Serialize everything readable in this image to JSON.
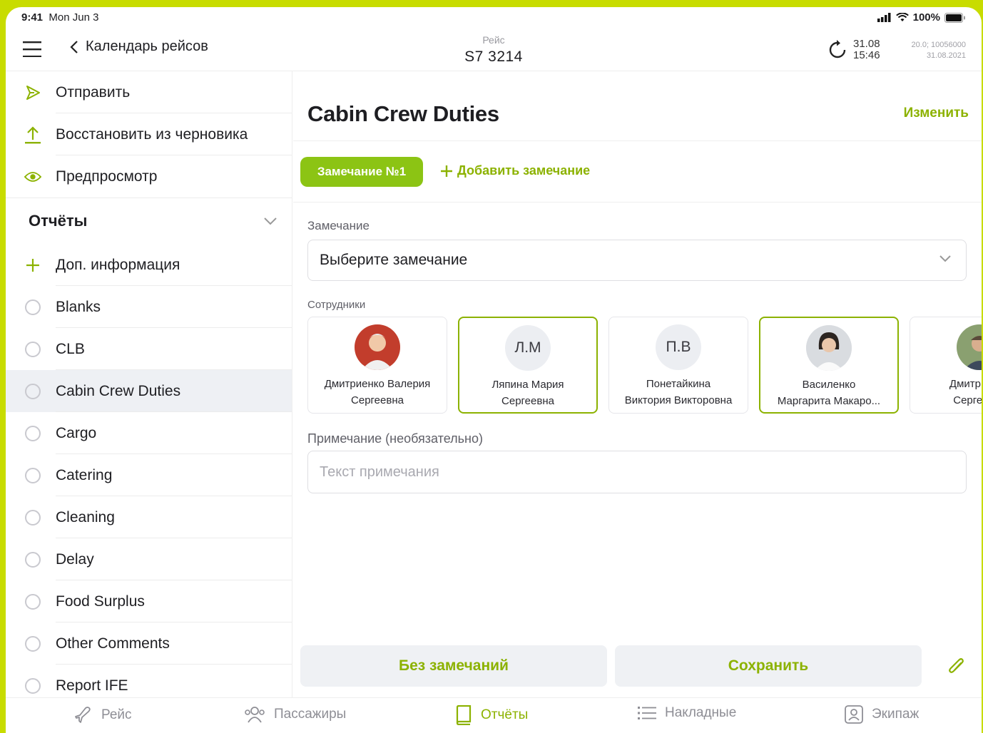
{
  "status_bar": {
    "time": "9:41",
    "date": "Mon Jun 3",
    "battery": "100%"
  },
  "nav": {
    "back_label": "Календарь рейсов",
    "flight_label": "Рейс",
    "flight_number": "S7 3214",
    "sync_date": "31.08",
    "sync_time": "15:46",
    "version_line1": "20.0; 10056000",
    "version_line2": "31.08.2021"
  },
  "sidebar": {
    "actions": [
      {
        "label": "Отправить",
        "icon": "send-icon"
      },
      {
        "label": "Восстановить из черновика",
        "icon": "upload-icon"
      },
      {
        "label": "Предпросмотр",
        "icon": "eye-icon"
      }
    ],
    "section_title": "Отчёты",
    "add_info": "Доп. информация",
    "reports": [
      "Blanks",
      "CLB",
      "Cabin Crew Duties",
      "Cargo",
      "Catering",
      "Cleaning",
      "Delay",
      "Food Surplus",
      "Other Comments",
      "Report IFE"
    ],
    "active_report": "Cabin Crew Duties"
  },
  "main": {
    "title": "Cabin Crew Duties",
    "edit_label": "Изменить",
    "remark_tab": "Замечание №1",
    "add_remark": "Добавить замечание",
    "remark_label": "Замечание",
    "remark_placeholder": "Выберите замечание",
    "employees_label": "Сотрудники",
    "employees": [
      {
        "initials": "",
        "line1": "Дмитриенко Валерия",
        "line2": "Сергеевна",
        "selected": false,
        "photo": true
      },
      {
        "initials": "Л.М",
        "line1": "Ляпина Мария",
        "line2": "Сергеевна",
        "selected": true,
        "photo": false
      },
      {
        "initials": "П.В",
        "line1": "Понетайкина",
        "line2": "Виктория Викторовна",
        "selected": false,
        "photo": false
      },
      {
        "initials": "",
        "line1": "Василенко",
        "line2": "Маргарита Макаро...",
        "selected": true,
        "photo": true
      },
      {
        "initials": "",
        "line1": "Дмитриенко",
        "line2": "Сергеевич",
        "selected": false,
        "photo": true
      }
    ],
    "note_label": "Примечание (необязательно)",
    "note_placeholder": "Текст примечания",
    "no_remarks_button": "Без замечаний",
    "save_button": "Сохранить"
  },
  "tabbar": [
    {
      "label": "Рейс",
      "icon": "plane-icon"
    },
    {
      "label": "Пассажиры",
      "icon": "passengers-icon"
    },
    {
      "label": "Отчёты",
      "icon": "book-icon"
    },
    {
      "label": "Накладные",
      "icon": "list-icon"
    },
    {
      "label": "Экипаж",
      "icon": "crew-icon"
    }
  ],
  "colors": {
    "accent": "#8cb200",
    "accent_chip": "#8cc414",
    "frame": "#c8dc00"
  }
}
